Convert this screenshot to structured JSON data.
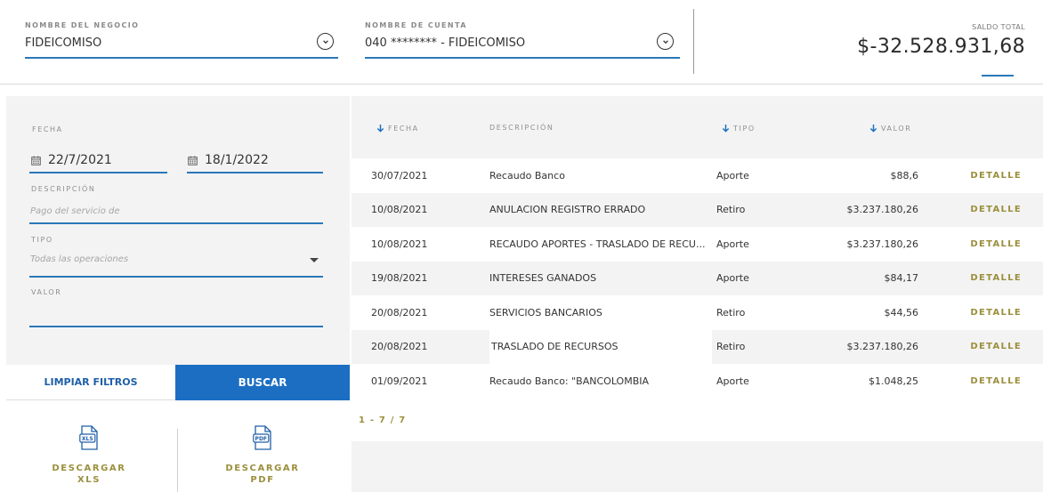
{
  "header": {
    "business_label": "NOMBRE DEL NEGOCIO",
    "business_value": "FIDEICOMISO",
    "account_label": "NOMBRE DE CUENTA",
    "account_value": "040 ******** - FIDEICOMISO",
    "balance_label": "SALDO TOTAL",
    "balance_value": "$-32.528.931,68"
  },
  "filters": {
    "date_label": "FECHA",
    "date_from": "22/7/2021",
    "date_to": "18/1/2022",
    "description_label": "DESCRIPCIÓN",
    "description_placeholder": "Pago del servicio de",
    "type_label": "TIPO",
    "type_value": "Todas las operaciones",
    "value_label": "VALOR",
    "value_value": "",
    "clear_label": "LIMPIAR FILTROS",
    "search_label": "BUSCAR"
  },
  "downloads": {
    "xls_label_1": "DESCARGAR",
    "xls_label_2": "XLS",
    "pdf_label_1": "DESCARGAR",
    "pdf_label_2": "PDF",
    "xls_badge": "XLS",
    "pdf_badge": "PDF"
  },
  "table": {
    "columns": [
      "FECHA",
      "DESCRIPCIÓN",
      "TIPO",
      "VALOR"
    ],
    "rows": [
      {
        "date": "30/07/2021",
        "desc": "Recaudo Banco",
        "tipo": "Aporte",
        "valor": "$88,6",
        "action": "DETALLE"
      },
      {
        "date": "10/08/2021",
        "desc": "ANULACION REGISTRO ERRADO",
        "tipo": "Retiro",
        "valor": "$3.237.180,26",
        "action": "DETALLE"
      },
      {
        "date": "10/08/2021",
        "desc": "RECAUDO APORTES - TRASLADO DE RECU...",
        "tipo": "Aporte",
        "valor": "$3.237.180,26",
        "action": "DETALLE"
      },
      {
        "date": "19/08/2021",
        "desc": "INTERESES GANADOS",
        "tipo": "Aporte",
        "valor": "$84,17",
        "action": "DETALLE"
      },
      {
        "date": "20/08/2021",
        "desc": "SERVICIOS BANCARIOS",
        "tipo": "Retiro",
        "valor": "$44,56",
        "action": "DETALLE"
      },
      {
        "date": "20/08/2021",
        "desc": "TRASLADO DE RECURSOS",
        "tipo": "Retiro",
        "valor": "$3.237.180,26",
        "action": "DETALLE"
      },
      {
        "date": "01/09/2021",
        "desc": "Recaudo Banco: \"BANCOLOMBIA",
        "tipo": "Aporte",
        "valor": "$1.048,25",
        "action": "DETALLE"
      }
    ],
    "pagination": "1 - 7 / 7"
  },
  "colors": {
    "accent_blue": "#2b77b8",
    "button_blue": "#1b6ec2",
    "gold": "#9b8f3c"
  },
  "icons": [
    "chevron-down-circle-icon",
    "calendar-icon",
    "caret-down-icon",
    "arrow-down-icon",
    "xls-file-icon",
    "pdf-file-icon"
  ]
}
